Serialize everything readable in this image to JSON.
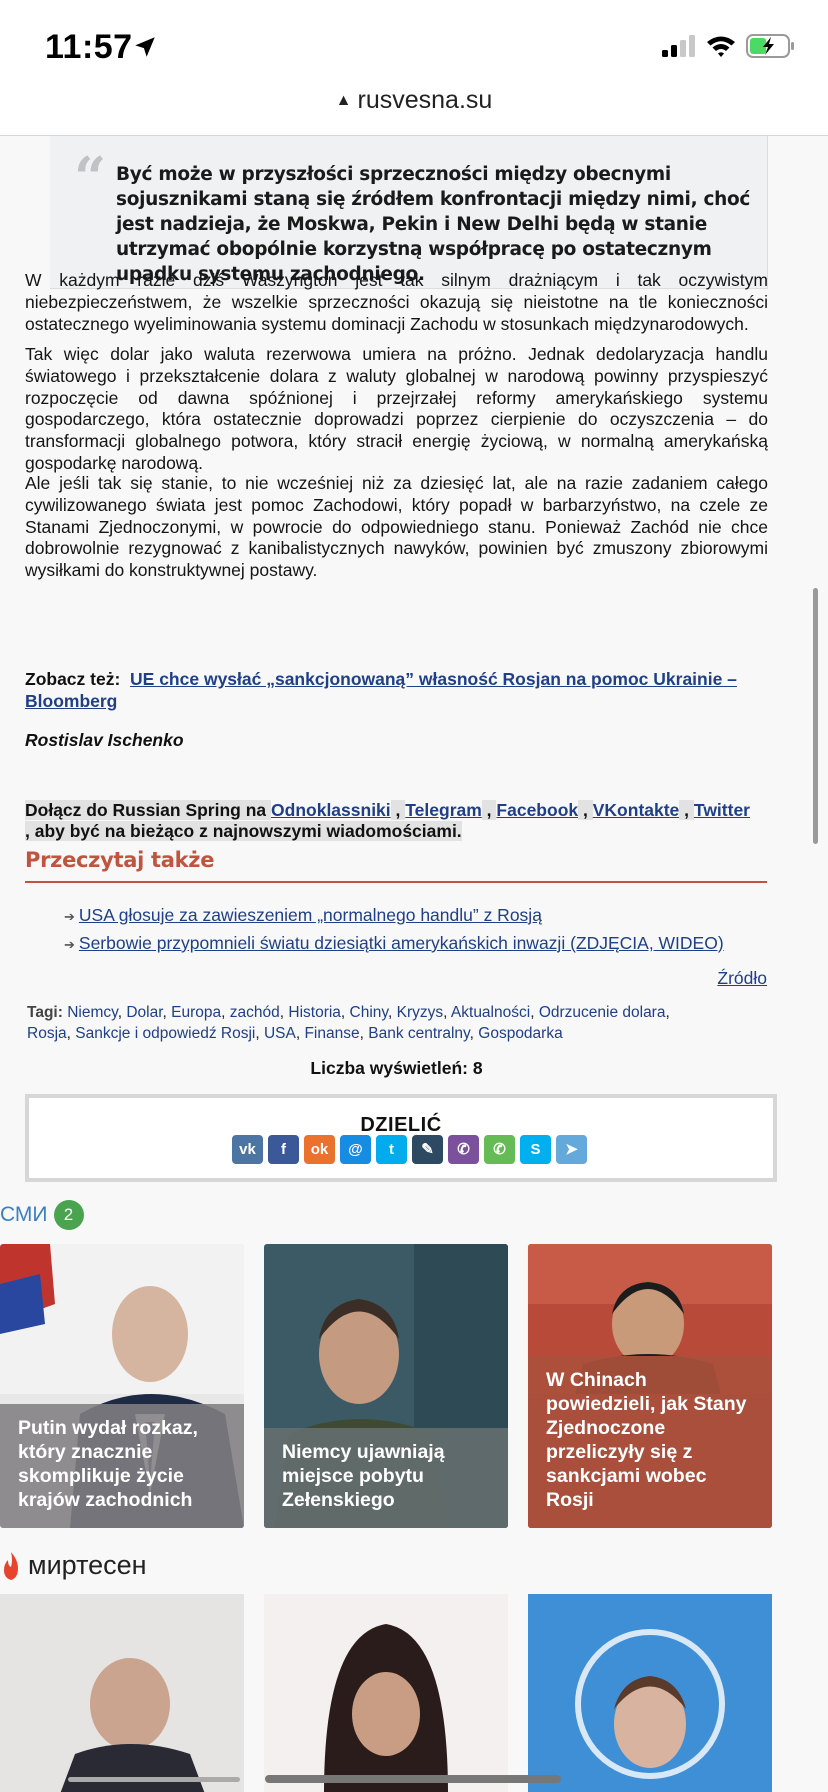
{
  "status_bar": {
    "time": "11:57",
    "battery_level": 0.45
  },
  "url_bar": {
    "domain": "rusvesna.su"
  },
  "article": {
    "quote": "Być może w przyszłości sprzeczności między obecnymi sojusznikami staną się źródłem konfrontacji między nimi, choć jest nadzieja, że Moskwa, Pekin i New Delhi będą w stanie utrzymać obopólnie korzystną współpracę po ostatecznym upadku systemu zachodniego.",
    "paragraphs": [
      "W każdym razie dziś Waszyngton jest tak silnym drażniącym i tak oczywistym niebezpieczeństwem, że wszelkie sprzeczności okazują się nieistotne na tle konieczności ostatecznego wyeliminowania systemu dominacji Zachodu w stosunkach międzynarodowych.",
      "Tak więc dolar jako waluta rezerwowa umiera na próżno. Jednak dedolaryzacja handlu światowego i przekształcenie dolara z waluty globalnej w narodową powinny przyspieszyć rozpoczęcie od dawna spóźnionej i przejrzałej reformy amerykańskiego systemu gospodarczego, która ostatecznie doprowadzi poprzez cierpienie do oczyszczenia – do transformacji globalnego potwora, który stracił energię życiową, w normalną amerykańską gospodarkę narodową.",
      "Ale jeśli tak się stanie, to nie wcześniej niż za dziesięć lat, ale na razie zadaniem całego cywilizowanego świata jest pomoc Zachodowi, który popadł w barbarzyństwo, na czele ze Stanami Zjednoczonymi, w powrocie do odpowiedniego stanu. Ponieważ Zachód nie chce dobrowolnie rezygnować z kanibalistycznych nawyków, powinien być zmuszony zbiorowymi wysiłkami do konstruktywnej postawy."
    ],
    "see_also_label": "Zobacz też:",
    "see_also_link": "UE chce wysłać „sankcjonowaną” własność Rosjan na pomoc Ukrainie – Bloomberg",
    "author": "Rostislav Ischenko"
  },
  "join": {
    "prefix": "Dołącz do Russian Spring na",
    "links": [
      "Odnoklassniki",
      "Telegram",
      "Facebook",
      "VKontakte",
      "Twitter"
    ],
    "separator": ",",
    "suffix": ", aby być na bieżąco z najnowszymi wiadomościami."
  },
  "read_also": {
    "title": "Przeczytaj także",
    "items": [
      "USA głosuje za zawieszeniem „normalnego handlu” z Rosją",
      "Serbowie przypomnieli światu dziesiątki amerykańskich inwazji (ZDJĘCIA, WIDEO)"
    ],
    "source_label": "Źródło"
  },
  "tags": {
    "label": "Tagi:",
    "items": [
      "Niemcy",
      "Dolar",
      "Europa",
      "zachód",
      "Historia",
      "Chiny",
      "Kryzys",
      "Aktualności",
      "Odrzucenie dolara",
      "Rosja",
      "Sankcje i odpowiedź Rosji",
      "USA",
      "Finanse",
      "Bank centralny",
      "Gospodarka"
    ]
  },
  "views": "Liczba wyświetleń: 8",
  "share": {
    "title": "DZIELIĆ",
    "buttons": [
      {
        "name": "vk-icon",
        "glyph": "vk",
        "color": "#4c75a3"
      },
      {
        "name": "facebook-icon",
        "glyph": "f",
        "color": "#3b5998"
      },
      {
        "name": "odnoklassniki-icon",
        "glyph": "ok",
        "color": "#eb722e"
      },
      {
        "name": "mailru-icon",
        "glyph": "@",
        "color": "#168de2"
      },
      {
        "name": "twitter-icon",
        "glyph": "t",
        "color": "#00aced"
      },
      {
        "name": "livejournal-icon",
        "glyph": "✎",
        "color": "#2d4a62"
      },
      {
        "name": "viber-icon",
        "glyph": "✆",
        "color": "#7b519d"
      },
      {
        "name": "whatsapp-icon",
        "glyph": "✆",
        "color": "#65bc54"
      },
      {
        "name": "skype-icon",
        "glyph": "S",
        "color": "#00aff0"
      },
      {
        "name": "telegram-icon",
        "glyph": "➤",
        "color": "#64a9dc"
      }
    ]
  },
  "smi": {
    "label": "СМИ",
    "badge": "2"
  },
  "cards": [
    {
      "caption": "Putin wydał rozkaz, który znacznie skomplikuje życie krajów zachodnich",
      "color": "#8d8a8c"
    },
    {
      "caption": "Niemcy ujawniają miejsce pobytu Zełenskiego",
      "color": "#6f7a78"
    },
    {
      "caption": "W Chinach powiedzieli, jak Stany Zjednoczone przeliczyły się z sankcjami wobec Rosji",
      "color": "#a8513e"
    }
  ],
  "mirtesen": {
    "label": "миртесен"
  }
}
